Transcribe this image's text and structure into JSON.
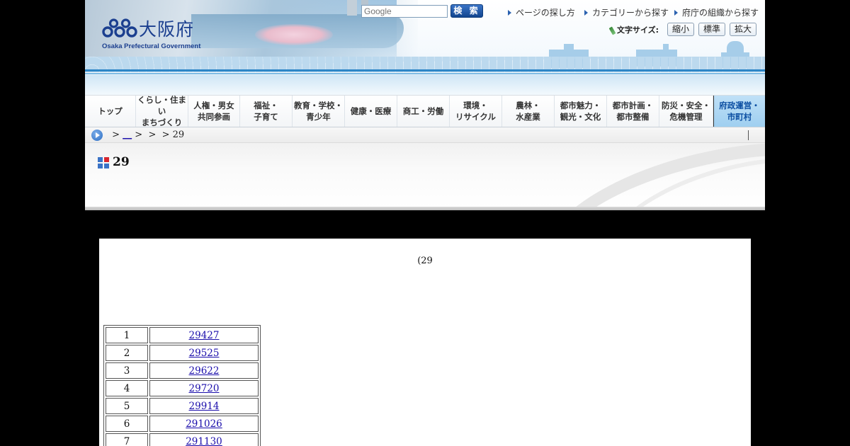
{
  "header": {
    "logo_text": "大阪府",
    "logo_sub": "Osaka Prefectural Government",
    "search": {
      "placeholder": "Google",
      "button_label": "検 索"
    },
    "top_links": [
      "ページの探し方",
      "カテゴリーから探す",
      "府庁の組織から探す"
    ],
    "font_size": {
      "label": "文字サイズ:",
      "buttons": [
        "縮小",
        "標準",
        "拡大"
      ]
    }
  },
  "nav": [
    "トップ",
    "くらし・住まい\nまちづくり",
    "人権・男女\n共同参画",
    "福祉・\n子育て",
    "教育・学校・\n青少年",
    "健康・医療",
    "商工・労働",
    "環境・\nリサイクル",
    "農林・\n水産業",
    "都市魅力・\n観光・文化",
    "都市計画・\n都市整備",
    "防災・安全・\n危機管理",
    "府政運営・\n市町村"
  ],
  "breadcrumb": {
    "sep1": " > ",
    "link": "__",
    "rest": " >  >  > 29"
  },
  "page_title": "29",
  "content": {
    "heading": "(29",
    "rows": [
      {
        "num": "1",
        "link": "29427"
      },
      {
        "num": "2",
        "link": "29525"
      },
      {
        "num": "3",
        "link": "29622"
      },
      {
        "num": "4",
        "link": "29720"
      },
      {
        "num": "5",
        "link": "29914"
      },
      {
        "num": "6",
        "link": "291026"
      },
      {
        "num": "7",
        "link": "291130"
      }
    ]
  }
}
